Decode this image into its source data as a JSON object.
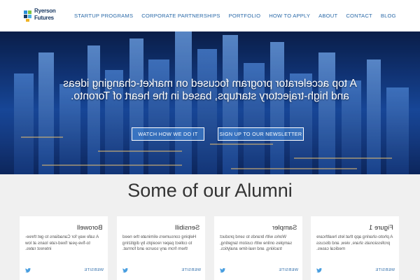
{
  "logo": {
    "line1": "Ryerson",
    "line2": "Futures"
  },
  "nav": {
    "items": [
      "STARTUP PROGRAMS",
      "CORPORATE PARTNERSHIPS",
      "PORTFOLIO",
      "HOW TO APPLY",
      "ABOUT",
      "CONTACT",
      "BLOG"
    ]
  },
  "hero": {
    "headline": "A top accelerator program focused on market-changing ideas and high-trajectory startups, based in the heart of Toronto.",
    "watch_label": "WATCH HOW WE DO IT",
    "signup_label": "SIGN UP TO OUR NEWSLETTER"
  },
  "alumni": {
    "title": "Some of our Alumni",
    "cards": [
      {
        "name": "Borowell",
        "desc": "A safe way for Canadians to get three-to-five-year fixed-rate loans at low interest rates.",
        "link": "WEBSITE"
      },
      {
        "name": "Sensibill",
        "desc": "Helping consumers eliminate the need to collect paper receipts by digitizing them from any source and format.",
        "link": "WEBSITE"
      },
      {
        "name": "Sampler",
        "desc": "Works with brands to send product samples online with custom targeting, tracking, and real-time analytics.",
        "link": "WEBSITE"
      },
      {
        "name": "Figure 1",
        "desc": "A photo-sharing app that lets healthcare professionals share, view, and discuss medical cases.",
        "link": "WEBSITE"
      }
    ]
  },
  "colors": {
    "nav_link": "#2b6aa8",
    "hero_blue": "#1a4ea6",
    "alumni_bg": "#f0f0f0",
    "card_bg": "#ffffff"
  }
}
